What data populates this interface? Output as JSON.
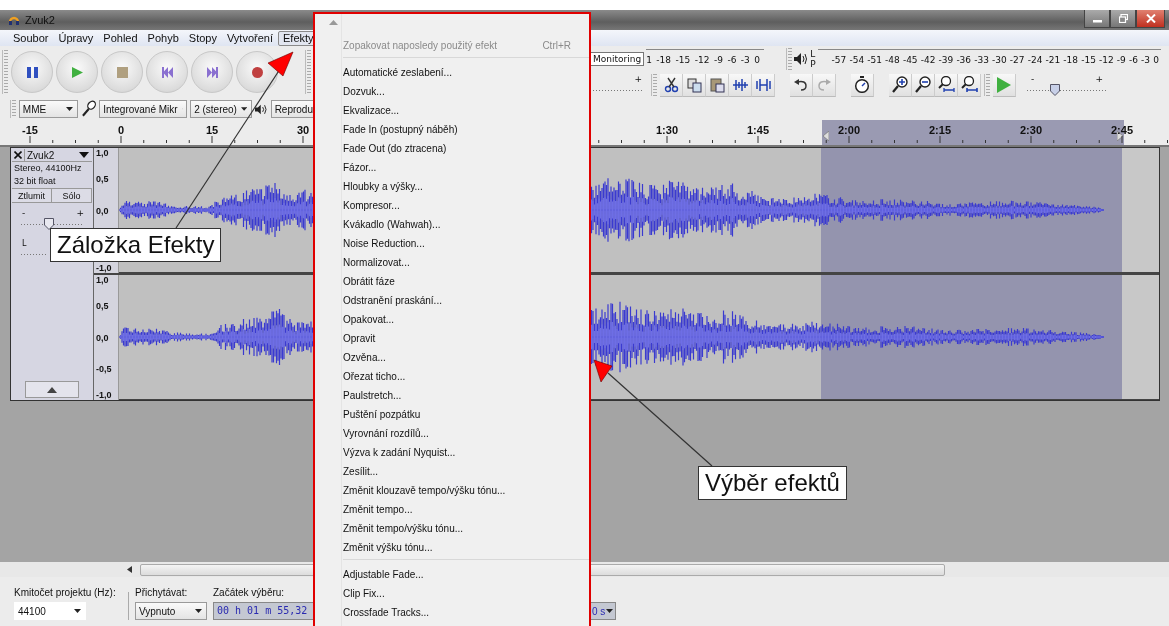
{
  "window": {
    "title": "Zvuk2"
  },
  "menu_bar": [
    {
      "label": "Soubor",
      "selected": false
    },
    {
      "label": "Úpravy",
      "selected": false
    },
    {
      "label": "Pohled",
      "selected": false
    },
    {
      "label": "Pohyb",
      "selected": false
    },
    {
      "label": "Stopy",
      "selected": false
    },
    {
      "label": "Vytvoření",
      "selected": false
    },
    {
      "label": "Efekty",
      "selected": true
    }
  ],
  "meters": {
    "monitoring": "Monitoring",
    "record_scale": [
      "1",
      "-18",
      "-15",
      "-12",
      "-9",
      "-6",
      "-3",
      "0"
    ],
    "playback_channels": [
      "L",
      "P"
    ],
    "playback_scale": [
      "-57",
      "-54",
      "-51",
      "-48",
      "-45",
      "-42",
      "-39",
      "-36",
      "-33",
      "-30",
      "-27",
      "-24",
      "-21",
      "-18",
      "-15",
      "-12",
      "-9",
      "-6",
      "-3",
      "0"
    ]
  },
  "edit_toolbar": {
    "input_slider_plus": "+",
    "speed_slider": {
      "minus": "-",
      "plus": "+",
      "level": 0.33
    }
  },
  "devices": {
    "host": "MME",
    "input": "Integrované Mikr",
    "channels": "2 (stereo)",
    "output": "Reprodu"
  },
  "ruler": {
    "labels": [
      "-15",
      "0",
      "15",
      "30",
      "1:30",
      "1:45",
      "2:00",
      "2:15",
      "2:30",
      "2:45"
    ]
  },
  "track": {
    "name": "Zvuk2",
    "info": [
      "Stereo, 44100Hz",
      "32 bit float"
    ],
    "buttons": [
      "Ztlumit",
      "Sólo"
    ],
    "gain": {
      "minus": "-",
      "plus": "+",
      "level": 0.45
    },
    "pan": {
      "left": "L"
    },
    "channels": [
      {
        "scale": [
          "1,0",
          "0,5",
          "0,0",
          "-1,0"
        ]
      },
      {
        "scale": [
          "1,0",
          "0,5",
          "0,0",
          "-0,5",
          "-1,0"
        ]
      }
    ]
  },
  "bottom_bar": {
    "rate_label": "Kmitočet projektu (Hz):",
    "rate": "44100",
    "snap_label": "Přichytávat:",
    "snap": "Vypnuto",
    "start_label": "Začátek výběru:",
    "start": "00 h 01 m 55,32",
    "end_unit": "0 s"
  },
  "effects_menu": [
    {
      "kind": "item",
      "label": "Zopakovat naposledy použitý efekt",
      "shortcut": "Ctrl+R",
      "disabled": true
    },
    {
      "kind": "separator"
    },
    {
      "kind": "item",
      "label": "Automatické zeslabení...",
      "disabled": false
    },
    {
      "kind": "item",
      "label": "Dozvuk...",
      "disabled": false
    },
    {
      "kind": "item",
      "label": "Ekvalizace...",
      "disabled": false
    },
    {
      "kind": "item",
      "label": "Fade In (postupný náběh)",
      "disabled": false
    },
    {
      "kind": "item",
      "label": "Fade Out (do ztracena)",
      "disabled": false
    },
    {
      "kind": "item",
      "label": "Fázor...",
      "disabled": false
    },
    {
      "kind": "item",
      "label": "Hloubky a výšky...",
      "disabled": false
    },
    {
      "kind": "item",
      "label": "Kompresor...",
      "disabled": false
    },
    {
      "kind": "item",
      "label": "Kvákadlo (Wahwah)...",
      "disabled": false
    },
    {
      "kind": "item",
      "label": "Noise Reduction...",
      "disabled": false
    },
    {
      "kind": "item",
      "label": "Normalizovat...",
      "disabled": false
    },
    {
      "kind": "item",
      "label": "Obrátit fáze",
      "disabled": false
    },
    {
      "kind": "item",
      "label": "Odstranění praskání...",
      "disabled": false
    },
    {
      "kind": "item",
      "label": "Opakovat...",
      "disabled": false
    },
    {
      "kind": "item",
      "label": "Opravit",
      "disabled": false
    },
    {
      "kind": "item",
      "label": "Ozvěna...",
      "disabled": false
    },
    {
      "kind": "item",
      "label": "Ořezat ticho...",
      "disabled": false
    },
    {
      "kind": "item",
      "label": "Paulstretch...",
      "disabled": false
    },
    {
      "kind": "item",
      "label": "Puštění pozpátku",
      "disabled": false
    },
    {
      "kind": "item",
      "label": "Vyrovnání rozdílů...",
      "disabled": false
    },
    {
      "kind": "item",
      "label": "Výzva k zadání Nyquist...",
      "disabled": false
    },
    {
      "kind": "item",
      "label": "Zesílit...",
      "disabled": false
    },
    {
      "kind": "item",
      "label": "Změnit klouzavě tempo/výšku tónu...",
      "disabled": false
    },
    {
      "kind": "item",
      "label": "Změnit tempo...",
      "disabled": false
    },
    {
      "kind": "item",
      "label": "Změnit tempo/výšku tónu...",
      "disabled": false
    },
    {
      "kind": "item",
      "label": "Změnit výšku tónu...",
      "disabled": false
    },
    {
      "kind": "separator"
    },
    {
      "kind": "item",
      "label": "Adjustable Fade...",
      "disabled": false
    },
    {
      "kind": "item",
      "label": "Clip Fix...",
      "disabled": false
    },
    {
      "kind": "item",
      "label": "Crossfade Tracks...",
      "disabled": false
    }
  ],
  "callouts": [
    {
      "text": "Záložka Efekty"
    },
    {
      "text": "Výběr efektů"
    }
  ]
}
